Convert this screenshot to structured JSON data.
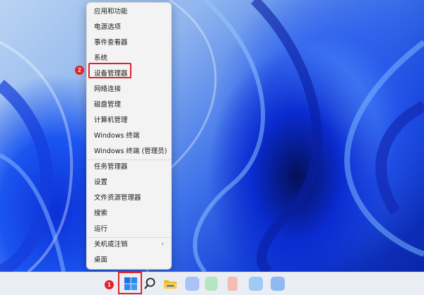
{
  "context_menu": {
    "items": [
      {
        "label": "应用和功能"
      },
      {
        "label": "电源选项"
      },
      {
        "label": "事件查看器"
      },
      {
        "label": "系统"
      },
      {
        "label": "设备管理器"
      },
      {
        "label": "网络连接"
      },
      {
        "label": "磁盘管理"
      },
      {
        "label": "计算机管理"
      },
      {
        "label": "Windows 终端"
      },
      {
        "label": "Windows 终端 (管理员)"
      },
      {
        "label": "任务管理器"
      },
      {
        "label": "设置"
      },
      {
        "label": "文件资源管理器"
      },
      {
        "label": "搜索"
      },
      {
        "label": "运行"
      },
      {
        "label": "关机或注销"
      },
      {
        "label": "桌面"
      }
    ],
    "submenu_glyph": "›",
    "highlighted_item": "设备管理器"
  },
  "annotations": {
    "step1": "1",
    "step2": "2",
    "highlight_color": "#e0232a"
  },
  "taskbar": {
    "icons": [
      "windows-start-icon",
      "search-icon",
      "file-explorer-icon",
      "app-icon",
      "app-icon",
      "app-icon",
      "app-icon",
      "app-icon"
    ]
  }
}
